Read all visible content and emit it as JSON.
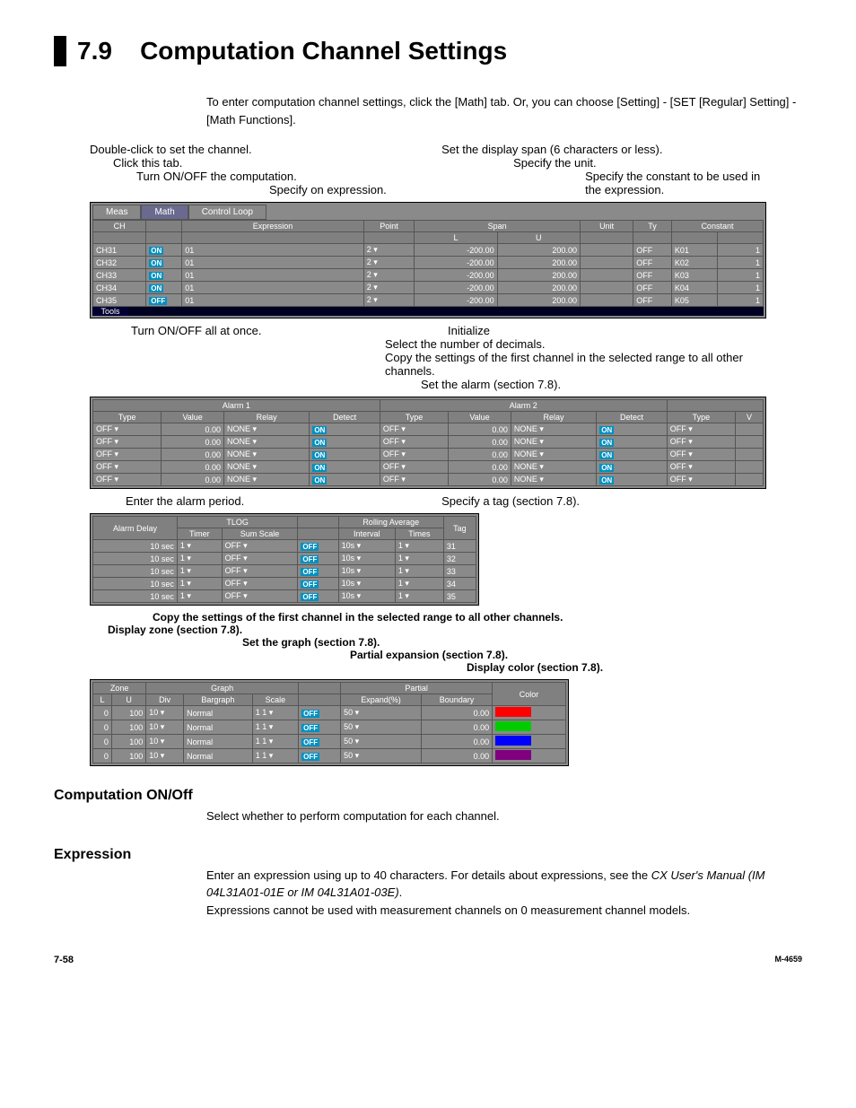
{
  "page": {
    "section_number": "7.9",
    "section_title": "Computation Channel Settings",
    "intro": "To enter computation channel settings, click the [Math] tab.  Or, you can choose [Setting] - [SET [Regular] Setting] - [Math Functions].",
    "footer_left": "7-58",
    "footer_right": "M-4659"
  },
  "callouts": {
    "dblclick": "Double-click to set the channel.",
    "click_tab": "Click this tab.",
    "on_off_comp": "Turn ON/OFF the computation.",
    "spec_expr": "Specify on expression.",
    "span": "Set the display span (6 characters or less).",
    "unit": "Specify the unit.",
    "constant": "Specify the constant to be used in the expression.",
    "turn_on_off_all": "Turn ON/OFF all at once.",
    "copy_settings": "Copy the settings of the first channel in the selected range to all other channels.",
    "initialize": "Initialize",
    "decimals": "Select the number of decimals.",
    "set_alarm": "Set the alarm (section 7.8).",
    "enter_alarm_period": "Enter the alarm period.",
    "specify_tag": "Specify a tag (section 7.8).",
    "copy_settings2": "Copy the settings of the first channel in the selected range to all other channels.",
    "display_zone": "Display zone (section 7.8).",
    "set_graph": "Set the graph (section 7.8).",
    "partial_expansion": "Partial expansion (section 7.8).",
    "display_color": "Display color (section 7.8)."
  },
  "grid1": {
    "tabs": {
      "meas": "Meas",
      "math": "Math",
      "control": "Control Loop"
    },
    "col_ch": "CH",
    "col_expr": "Expression",
    "col_point": "Point",
    "col_span": "Span",
    "col_L": "L",
    "col_U": "U",
    "col_unit": "Unit",
    "col_ty": "Ty",
    "col_const": "Constant",
    "rows": [
      {
        "ch": "CH31",
        "on": "ON",
        "expr": "01",
        "pt": "2",
        "l": "-200.00",
        "u": "200.00",
        "ty": "OFF",
        "k": "K01",
        "v": "1"
      },
      {
        "ch": "CH32",
        "on": "ON",
        "expr": "01",
        "pt": "2",
        "l": "-200.00",
        "u": "200.00",
        "ty": "OFF",
        "k": "K02",
        "v": "1"
      },
      {
        "ch": "CH33",
        "on": "ON",
        "expr": "01",
        "pt": "2",
        "l": "-200.00",
        "u": "200.00",
        "ty": "OFF",
        "k": "K03",
        "v": "1"
      },
      {
        "ch": "CH34",
        "on": "ON",
        "expr": "01",
        "pt": "2",
        "l": "-200.00",
        "u": "200.00",
        "ty": "OFF",
        "k": "K04",
        "v": "1"
      },
      {
        "ch": "CH35",
        "on": "OFF",
        "expr": "01",
        "pt": "2",
        "l": "-200.00",
        "u": "200.00",
        "ty": "OFF",
        "k": "K05",
        "v": "1"
      }
    ],
    "footer_tools": "Tools"
  },
  "grid2": {
    "alarm1": "Alarm 1",
    "alarm2": "Alarm 2",
    "type": "Type",
    "value": "Value",
    "relay": "Relay",
    "detect": "Detect",
    "rows": [
      {
        "t1": "OFF",
        "v1": "0.00",
        "r1": "NONE",
        "d1": "ON",
        "t2": "OFF",
        "v2": "0.00",
        "r2": "NONE",
        "d2": "ON",
        "t3": "OFF"
      },
      {
        "t1": "OFF",
        "v1": "0.00",
        "r1": "NONE",
        "d1": "ON",
        "t2": "OFF",
        "v2": "0.00",
        "r2": "NONE",
        "d2": "ON",
        "t3": "OFF"
      },
      {
        "t1": "OFF",
        "v1": "0.00",
        "r1": "NONE",
        "d1": "ON",
        "t2": "OFF",
        "v2": "0.00",
        "r2": "NONE",
        "d2": "ON",
        "t3": "OFF"
      },
      {
        "t1": "OFF",
        "v1": "0.00",
        "r1": "NONE",
        "d1": "ON",
        "t2": "OFF",
        "v2": "0.00",
        "r2": "NONE",
        "d2": "ON",
        "t3": "OFF"
      },
      {
        "t1": "OFF",
        "v1": "0.00",
        "r1": "NONE",
        "d1": "ON",
        "t2": "OFF",
        "v2": "0.00",
        "r2": "NONE",
        "d2": "ON",
        "t3": "OFF"
      }
    ]
  },
  "grid3": {
    "alarm_delay": "Alarm Delay",
    "tlog": "TLOG",
    "timer": "Timer",
    "sum_scale": "Sum Scale",
    "rolling_avg": "Rolling Average",
    "interval": "Interval",
    "times": "Times",
    "tag": "Tag",
    "rows": [
      {
        "ad": "10 sec",
        "t": "1",
        "ss": "OFF",
        "ra": "OFF",
        "itv": "10s",
        "tm": "1",
        "tag": "31"
      },
      {
        "ad": "10 sec",
        "t": "1",
        "ss": "OFF",
        "ra": "OFF",
        "itv": "10s",
        "tm": "1",
        "tag": "32"
      },
      {
        "ad": "10 sec",
        "t": "1",
        "ss": "OFF",
        "ra": "OFF",
        "itv": "10s",
        "tm": "1",
        "tag": "33"
      },
      {
        "ad": "10 sec",
        "t": "1",
        "ss": "OFF",
        "ra": "OFF",
        "itv": "10s",
        "tm": "1",
        "tag": "34"
      },
      {
        "ad": "10 sec",
        "t": "1",
        "ss": "OFF",
        "ra": "OFF",
        "itv": "10s",
        "tm": "1",
        "tag": "35"
      }
    ]
  },
  "grid4": {
    "zone": "Zone",
    "L": "L",
    "U": "U",
    "graph": "Graph",
    "div": "Div",
    "bargraph": "Bargraph",
    "scale": "Scale",
    "partial": "Partial",
    "expand": "Expand(%)",
    "boundary": "Boundary",
    "color": "Color",
    "rows": [
      {
        "l": "0",
        "u": "100",
        "div": "10",
        "bar": "Normal",
        "sc": "1 1",
        "p": "OFF",
        "ex": "50",
        "bd": "0.00",
        "color": "c-red"
      },
      {
        "l": "0",
        "u": "100",
        "div": "10",
        "bar": "Normal",
        "sc": "1 1",
        "p": "OFF",
        "ex": "50",
        "bd": "0.00",
        "color": "c-green"
      },
      {
        "l": "0",
        "u": "100",
        "div": "10",
        "bar": "Normal",
        "sc": "1 1",
        "p": "OFF",
        "ex": "50",
        "bd": "0.00",
        "color": "c-blue"
      },
      {
        "l": "0",
        "u": "100",
        "div": "10",
        "bar": "Normal",
        "sc": "1 1",
        "p": "OFF",
        "ex": "50",
        "bd": "0.00",
        "color": "c-purple"
      }
    ]
  },
  "sections": {
    "comp_on_off_h": "Computation ON/Off",
    "comp_on_off_t": "Select whether to perform computation for each channel.",
    "expr_h": "Expression",
    "expr_t1": "Enter an expression using up to 40 characters.  For details about expressions, see the ",
    "expr_manual": "CX User's Manual (IM 04L31A01-01E or IM 04L31A01-03E)",
    "expr_t2": "Expressions cannot be used with measurement channels on 0 measurement channel models."
  }
}
